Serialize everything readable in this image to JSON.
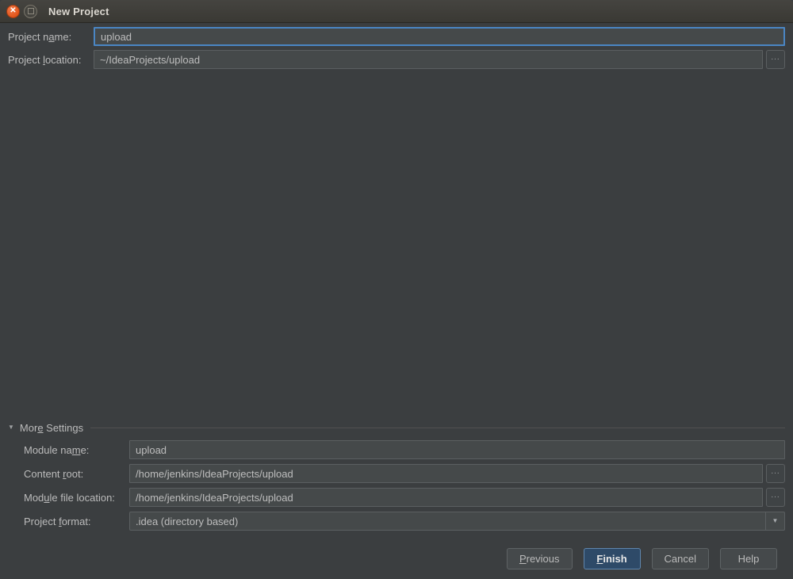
{
  "window": {
    "title": "New Project"
  },
  "icons": {
    "close": "✕",
    "disclosure": "▼",
    "combo_arrow": "▼",
    "browse": "..."
  },
  "top_form": {
    "project_name": {
      "label": {
        "pre": "Project n",
        "mn": "a",
        "post": "me:"
      },
      "value": "upload"
    },
    "project_location": {
      "label": {
        "pre": "Project ",
        "mn": "l",
        "post": "ocation:"
      },
      "value": "~/IdeaProjects/upload"
    }
  },
  "more_settings": {
    "title": {
      "pre": "Mor",
      "mn": "e",
      "post": " Settings"
    },
    "module_name": {
      "label": {
        "pre": "Module na",
        "mn": "m",
        "post": "e:"
      },
      "value": "upload"
    },
    "content_root": {
      "label": {
        "pre": "Content ",
        "mn": "r",
        "post": "oot:"
      },
      "value": "/home/jenkins/IdeaProjects/upload"
    },
    "module_file_location": {
      "label": {
        "pre": "Mod",
        "mn": "u",
        "post": "le file location:"
      },
      "value": "/home/jenkins/IdeaProjects/upload"
    },
    "project_format": {
      "label": {
        "pre": "Project ",
        "mn": "f",
        "post": "ormat:"
      },
      "value": ".idea (directory based)"
    }
  },
  "buttons": {
    "previous": {
      "pre": "",
      "mn": "P",
      "post": "revious"
    },
    "finish": {
      "pre": "",
      "mn": "F",
      "post": "inish"
    },
    "cancel": {
      "pre": "Cancel",
      "mn": "",
      "post": ""
    },
    "help": {
      "pre": "Help",
      "mn": "",
      "post": ""
    }
  },
  "colors": {
    "dialog_bg": "#3b3e40",
    "titlebar_bg": "#3c3b37",
    "input_bg": "#45494a",
    "input_border": "#5b5f61",
    "focus_border": "#4a86c4",
    "label_text": "#bbbbbb",
    "separator": "#515151",
    "default_button_bg": "#2e4a68",
    "default_button_border": "#5f86ad",
    "close_button_orange": "#e25419"
  }
}
